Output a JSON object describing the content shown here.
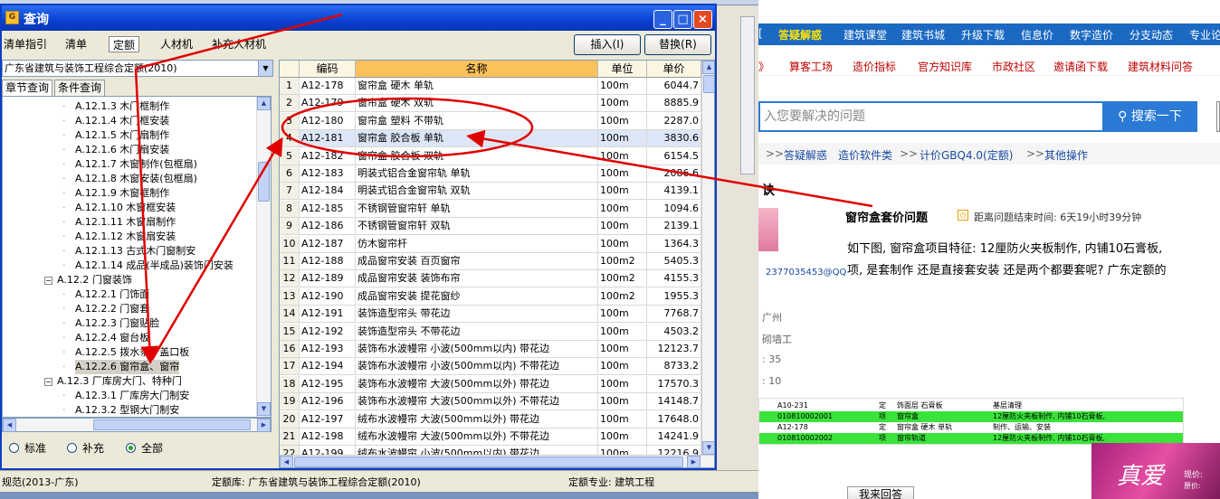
{
  "dialog": {
    "title": "查询",
    "tabs": [
      "清单指引",
      "清单",
      "定额",
      "人材机",
      "补充人材机"
    ],
    "active_tab": "定额",
    "insert_label": "插入(I)",
    "replace_label": "替换(R)",
    "library_select": "广东省建筑与装饰工程综合定额(2010)",
    "subtabs": [
      "章节查询",
      "条件查询"
    ],
    "tree": [
      {
        "code": "A.12.1.3",
        "label": "木门框制作",
        "level": 2
      },
      {
        "code": "A.12.1.4",
        "label": "木门框安装",
        "level": 2
      },
      {
        "code": "A.12.1.5",
        "label": "木门扇制作",
        "level": 2
      },
      {
        "code": "A.12.1.6",
        "label": "木门扇安装",
        "level": 2
      },
      {
        "code": "A.12.1.7",
        "label": "木窗制作(包框扇)",
        "level": 2
      },
      {
        "code": "A.12.1.8",
        "label": "木窗安装(包框扇)",
        "level": 2
      },
      {
        "code": "A.12.1.9",
        "label": "木窗框制作",
        "level": 2
      },
      {
        "code": "A.12.1.10",
        "label": "木窗框安装",
        "level": 2
      },
      {
        "code": "A.12.1.11",
        "label": "木窗扇制作",
        "level": 2
      },
      {
        "code": "A.12.1.12",
        "label": "木窗扇安装",
        "level": 2
      },
      {
        "code": "A.12.1.13",
        "label": "古式木门窗制安",
        "level": 2
      },
      {
        "code": "A.12.1.14",
        "label": "成品(半成品)装饰门安装",
        "level": 2
      },
      {
        "code": "A.12.2",
        "label": "门窗装饰",
        "level": 1
      },
      {
        "code": "A.12.2.1",
        "label": "门饰面",
        "level": 2
      },
      {
        "code": "A.12.2.2",
        "label": "门窗套",
        "level": 2
      },
      {
        "code": "A.12.2.3",
        "label": "门窗贴脸",
        "level": 2
      },
      {
        "code": "A.12.2.4",
        "label": "窗台板",
        "level": 2
      },
      {
        "code": "A.12.2.5",
        "label": "拨水条、盖口板",
        "level": 2
      },
      {
        "code": "A.12.2.6",
        "label": "窗帘盒、窗帘",
        "level": 2,
        "selected": true
      },
      {
        "code": "A.12.3",
        "label": "厂库房大门、特种门",
        "level": 1
      },
      {
        "code": "A.12.3.1",
        "label": "厂库房大门制安",
        "level": 2
      },
      {
        "code": "A.12.3.2",
        "label": "型钢大门制安",
        "level": 2
      }
    ],
    "filter": {
      "options": [
        "标准",
        "补充",
        "全部"
      ],
      "selected": "全部"
    },
    "grid": {
      "headers": [
        "编码",
        "名称",
        "单位",
        "单价"
      ],
      "rows": [
        {
          "no": "1",
          "code": "A12-178",
          "name": "窗帘盒 硬木 单轨",
          "unit": "100m",
          "price": "6044.7"
        },
        {
          "no": "2",
          "code": "A12-179",
          "name": "窗帘盒 硬木 双轨",
          "unit": "100m",
          "price": "8885.9"
        },
        {
          "no": "3",
          "code": "A12-180",
          "name": "窗帘盒 塑料 不带轨",
          "unit": "100m",
          "price": "2287.0"
        },
        {
          "no": "4",
          "code": "A12-181",
          "name": "窗帘盒 胶合板 单轨",
          "unit": "100m",
          "price": "3830.6"
        },
        {
          "no": "5",
          "code": "A12-182",
          "name": "窗帘盒 胶合板 双轨",
          "unit": "100m",
          "price": "6154.5"
        },
        {
          "no": "6",
          "code": "A12-183",
          "name": "明装式铝合金窗帘轨 单轨",
          "unit": "100m",
          "price": "2086.6"
        },
        {
          "no": "7",
          "code": "A12-184",
          "name": "明装式铝合金窗帘轨 双轨",
          "unit": "100m",
          "price": "4139.1"
        },
        {
          "no": "8",
          "code": "A12-185",
          "name": "不锈钢管窗帘轩 单轨",
          "unit": "100m",
          "price": "1094.6"
        },
        {
          "no": "9",
          "code": "A12-186",
          "name": "不锈钢管窗帘轩 双轨",
          "unit": "100m",
          "price": "2139.1"
        },
        {
          "no": "10",
          "code": "A12-187",
          "name": "仿木窗帘杆",
          "unit": "100m",
          "price": "1364.3"
        },
        {
          "no": "11",
          "code": "A12-188",
          "name": "成品窗帘安装 百页窗帘",
          "unit": "100m2",
          "price": "5405.3"
        },
        {
          "no": "12",
          "code": "A12-189",
          "name": "成品窗帘安装 装饰布帘",
          "unit": "100m2",
          "price": "4155.3"
        },
        {
          "no": "13",
          "code": "A12-190",
          "name": "成品窗帘安装 提花窗纱",
          "unit": "100m2",
          "price": "1955.3"
        },
        {
          "no": "14",
          "code": "A12-191",
          "name": "装饰造型帘头 带花边",
          "unit": "100m",
          "price": "7768.7"
        },
        {
          "no": "15",
          "code": "A12-192",
          "name": "装饰造型帘头 不带花边",
          "unit": "100m",
          "price": "4503.2"
        },
        {
          "no": "16",
          "code": "A12-193",
          "name": "装饰布水波幔帘 小波(500mm以内) 带花边",
          "unit": "100m",
          "price": "12123.7"
        },
        {
          "no": "17",
          "code": "A12-194",
          "name": "装饰布水波幔帘 小波(500mm以内) 不带花边",
          "unit": "100m",
          "price": "8733.2"
        },
        {
          "no": "18",
          "code": "A12-195",
          "name": "装饰布水波幔帘 大波(500mm以外) 带花边",
          "unit": "100m",
          "price": "17570.3"
        },
        {
          "no": "19",
          "code": "A12-196",
          "name": "装饰布水波幔帘 大波(500mm以外) 不带花边",
          "unit": "100m",
          "price": "14148.7"
        },
        {
          "no": "20",
          "code": "A12-197",
          "name": "绒布水波幔帘 大波(500mm以外) 带花边",
          "unit": "100m",
          "price": "17648.0"
        },
        {
          "no": "21",
          "code": "A12-198",
          "name": "绒布水波幔帘 大波(500mm以外) 不带花边",
          "unit": "100m",
          "price": "14241.9"
        },
        {
          "no": "22",
          "code": "A12-199",
          "name": "绒布水波幔帘 小波(500mm以内) 带花边",
          "unit": "100m",
          "price": "12216.9"
        }
      ]
    }
  },
  "statusbar": {
    "spec": "规范(2013-广东)",
    "library": "定额库: 广东省建筑与装饰工程综合定额(2010)",
    "major": "定额专业: 建筑工程"
  },
  "web": {
    "nav1": [
      "答疑解惑",
      "建筑课堂",
      "建筑书城",
      "升级下载",
      "信息价",
      "数字造价",
      "分支动态",
      "专业论"
    ],
    "nav2": [
      "算客工场",
      "造价指标",
      "官方知识库",
      "市政社区",
      "邀请函下载",
      "建筑材料问答"
    ],
    "search_placeholder": "入您要解决的问题",
    "search_button": "搜索一下",
    "breadcrumb": [
      "答疑解惑",
      "造价软件类",
      "计价GBQ4.0(定额)",
      "其他操作"
    ],
    "section_label": "诀",
    "question_title": "窗帘盒套价问题",
    "time_left": "距离问题结束时间: 6天19小时39分钟",
    "question_line1": "如下图, 窗帘盒项目特征: 12厘防火夹板制作, 内铺10石膏板,",
    "question_line2": "项, 是套制作 还是直接套安装 还是两个都要套呢? 广东定额的",
    "user_qq": "2377035453@QQ",
    "city": "广州",
    "job": "砌墙工",
    "stat1": ": 35",
    "stat2": ": 10",
    "embed_rows": [
      {
        "c1": "A10-231",
        "c2": "定",
        "c3": "饰面层 石膏板",
        "c4": "基层清理",
        "green": false
      },
      {
        "c1": "010810002001",
        "c2": "项",
        "c3": "窗帘盒",
        "c4": "12厘防火夹板制作, 内铺10石膏板,",
        "green": true
      },
      {
        "c1": "A12-178",
        "c2": "定",
        "c3": "窗帘盒 硬木 单轨",
        "c4": "制作、运输、安装",
        "green": false
      },
      {
        "c1": "010810002002",
        "c2": "项",
        "c3": "窗帘轨道",
        "c4": "12厘防火夹板制作, 内铺10石膏板,",
        "green": true
      }
    ],
    "answer_button": "我来回答",
    "ad_text": "真爱",
    "ad_price1": "现价:",
    "ad_price2": "原价:"
  },
  "colors": {
    "title_blue": "#0a40d0",
    "nav_blue": "#1b69c2",
    "annotation_red": "#e00000",
    "highlight_green": "#39e339"
  }
}
